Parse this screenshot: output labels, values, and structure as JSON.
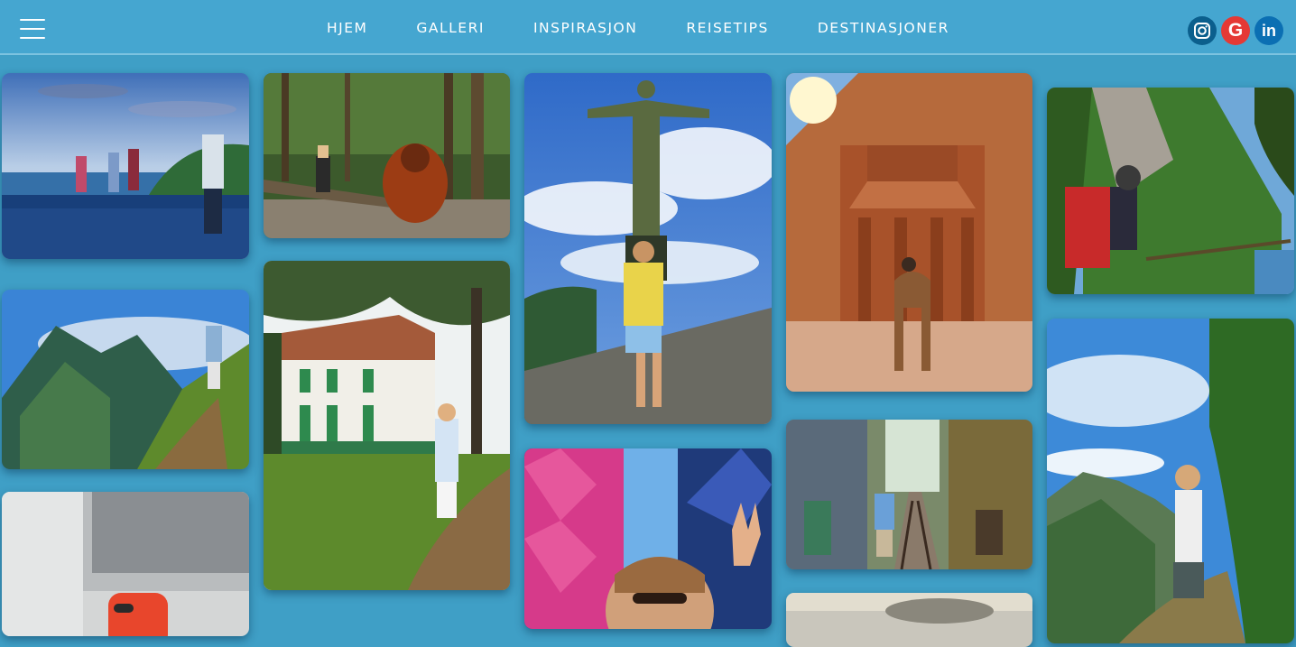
{
  "nav": {
    "menu_icon": "hamburger-menu-icon",
    "links": [
      "HJEM",
      "GALLERI",
      "INSPIRASJON",
      "REISETIPS",
      "DESTINASJONER"
    ]
  },
  "social": [
    {
      "icon": "instagram-icon",
      "color": "#0b5f8d"
    },
    {
      "icon": "google-icon",
      "color": "#e53935",
      "glyph": "G"
    },
    {
      "icon": "linkedin-icon",
      "color": "#0b6fb3",
      "glyph": "in"
    }
  ],
  "colors": {
    "background": "#3f9fc6",
    "header": "#45a6d0",
    "text": "#ffffff"
  },
  "gallery": {
    "photos": [
      {
        "subject": "infinity-pool-coast"
      },
      {
        "subject": "orangutan-rainforest"
      },
      {
        "subject": "christ-the-redeemer"
      },
      {
        "subject": "petra-treasury-camel"
      },
      {
        "subject": "cliff-coast-backpacker"
      },
      {
        "subject": "mountain-ridge-hiker"
      },
      {
        "subject": "colonial-house-garden"
      },
      {
        "subject": "festival-crowd-peace-sign"
      },
      {
        "subject": "hanoi-train-street"
      },
      {
        "subject": "cliff-view-traveler"
      },
      {
        "subject": "phone-close-up"
      },
      {
        "subject": "cloudy-landscape"
      }
    ]
  }
}
